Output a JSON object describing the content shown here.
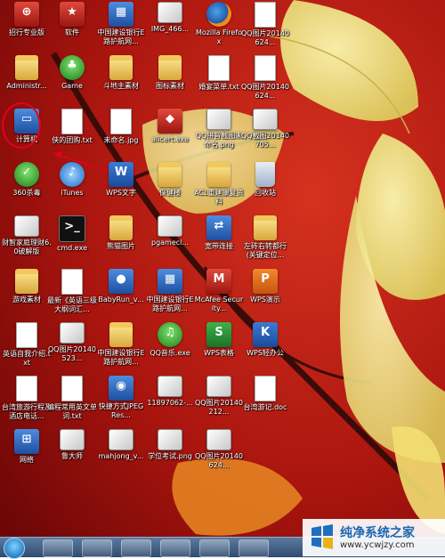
{
  "desktop": {
    "icons": [
      {
        "label": "招行专业版",
        "kind": "red",
        "glyph": "⊕"
      },
      {
        "label": "软件",
        "kind": "star",
        "glyph": "★"
      },
      {
        "label": "中国建设银行E路护航网...",
        "kind": "app",
        "glyph": "▦"
      },
      {
        "label": "IMG_466...",
        "kind": "img",
        "glyph": ""
      },
      {
        "label": "Mozilla Firefox",
        "kind": "firefox",
        "glyph": ""
      },
      {
        "label": "QQ图片20140624...",
        "kind": "doc",
        "glyph": ""
      },
      {
        "label": "Administr...",
        "kind": "folder",
        "glyph": ""
      },
      {
        "label": "Game",
        "kind": "tree",
        "glyph": "♣"
      },
      {
        "label": "斗地主素材",
        "kind": "folder",
        "glyph": ""
      },
      {
        "label": "图标素材",
        "kind": "folder",
        "glyph": ""
      },
      {
        "label": "婚宴菜单.txt",
        "kind": "doc",
        "glyph": ""
      },
      {
        "label": "QQ图片20140624...",
        "kind": "doc",
        "glyph": ""
      },
      {
        "label": "计算机",
        "kind": "app",
        "glyph": "▭"
      },
      {
        "label": "侠的团购.txt",
        "kind": "doc",
        "glyph": ""
      },
      {
        "label": "未命名.jpg",
        "kind": "doc",
        "glyph": ""
      },
      {
        "label": "alicert.exe",
        "kind": "shield",
        "glyph": "◆"
      },
      {
        "label": "QQ拼音截图未命名.png",
        "kind": "img",
        "glyph": ""
      },
      {
        "label": "QQ截图20140705...",
        "kind": "img",
        "glyph": ""
      },
      {
        "label": "360杀毒",
        "kind": "green",
        "glyph": "✓"
      },
      {
        "label": "iTunes",
        "kind": "ie",
        "glyph": "♪"
      },
      {
        "label": "WPS文字",
        "kind": "wps",
        "glyph": "W"
      },
      {
        "label": "保健楼",
        "kind": "folder",
        "glyph": ""
      },
      {
        "label": "ACL重建康复资料",
        "kind": "folder",
        "glyph": ""
      },
      {
        "label": "回收站",
        "kind": "bin",
        "glyph": ""
      },
      {
        "label": "财智家庭理财6.0破解版",
        "kind": "img",
        "glyph": ""
      },
      {
        "label": "cmd.exe",
        "kind": "cmd",
        "glyph": ">_"
      },
      {
        "label": "熊猫图片",
        "kind": "folder",
        "glyph": ""
      },
      {
        "label": "pgamecl...",
        "kind": "img",
        "glyph": ""
      },
      {
        "label": "宽带连接",
        "kind": "app",
        "glyph": "⇄"
      },
      {
        "label": "左砖右转都行(关键定位...",
        "kind": "folder",
        "glyph": ""
      },
      {
        "label": "游戏素材",
        "kind": "folder",
        "glyph": ""
      },
      {
        "label": "最新《英语三级大纲词汇...",
        "kind": "doc",
        "glyph": ""
      },
      {
        "label": "BabyRun_v...",
        "kind": "app",
        "glyph": "●"
      },
      {
        "label": "中国建设银行E路护航网...",
        "kind": "app",
        "glyph": "▦"
      },
      {
        "label": "McAfee Security...",
        "kind": "red",
        "glyph": "M"
      },
      {
        "label": "WPS演示",
        "kind": "wpso",
        "glyph": "P"
      },
      {
        "label": "英语自我介绍.txt",
        "kind": "doc",
        "glyph": ""
      },
      {
        "label": "QQ图片20140523...",
        "kind": "img",
        "glyph": ""
      },
      {
        "label": "中国建设银行E路护航网...",
        "kind": "folder",
        "glyph": ""
      },
      {
        "label": "QQ音乐.exe",
        "kind": "green",
        "glyph": "♫"
      },
      {
        "label": "WPS表格",
        "kind": "wpsg",
        "glyph": "S"
      },
      {
        "label": "WPS轻办公",
        "kind": "wps",
        "glyph": "K"
      },
      {
        "label": "台湾旅游行程及酒店电话...",
        "kind": "doc",
        "glyph": ""
      },
      {
        "label": "编程常用英文单词.txt",
        "kind": "doc",
        "glyph": ""
      },
      {
        "label": "快捷方式JPEG Res...",
        "kind": "app",
        "glyph": "◉"
      },
      {
        "label": "11897062-...",
        "kind": "img",
        "glyph": ""
      },
      {
        "label": "QQ图片20140212...",
        "kind": "img",
        "glyph": ""
      },
      {
        "label": "台湾游记.doc",
        "kind": "doc",
        "glyph": ""
      },
      {
        "label": "网络",
        "kind": "app",
        "glyph": "⊞"
      },
      {
        "label": "鲁大师",
        "kind": "img",
        "glyph": ""
      },
      {
        "label": "mahjong_v...",
        "kind": "img",
        "glyph": ""
      },
      {
        "label": "学位考试.png",
        "kind": "img",
        "glyph": ""
      },
      {
        "label": "QQ图片20140624...",
        "kind": "img",
        "glyph": ""
      }
    ]
  },
  "taskbar": {
    "pinned": [
      "explorer",
      "media-player",
      "internet-explorer",
      "qq",
      "bird-app",
      "sports-app"
    ]
  },
  "watermark": {
    "title": "纯净系统之家",
    "url": "www.ycwjzy.com"
  }
}
